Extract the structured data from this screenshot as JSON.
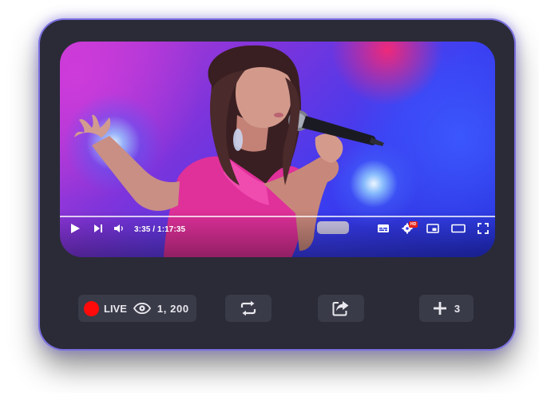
{
  "player": {
    "time": "3:35 / 1:17:35",
    "hd_badge": "HD",
    "progress_fraction": 0.0,
    "colors": {
      "card_background": "#2a2b37",
      "card_glow": "#7b6fe0",
      "pill_background": "#3a3b48",
      "live_dot": "#ff0a0a"
    },
    "icons": [
      "play-icon",
      "skip-next-icon",
      "volume-icon",
      "subtitles-icon",
      "settings-icon",
      "miniplayer-icon",
      "theater-mode-icon",
      "fullscreen-icon"
    ]
  },
  "actions": {
    "live_label": "LIVE",
    "views": "1, 200",
    "add_count": "3",
    "icons": [
      "eye-icon",
      "repeat-icon",
      "share-icon",
      "plus-icon"
    ]
  }
}
